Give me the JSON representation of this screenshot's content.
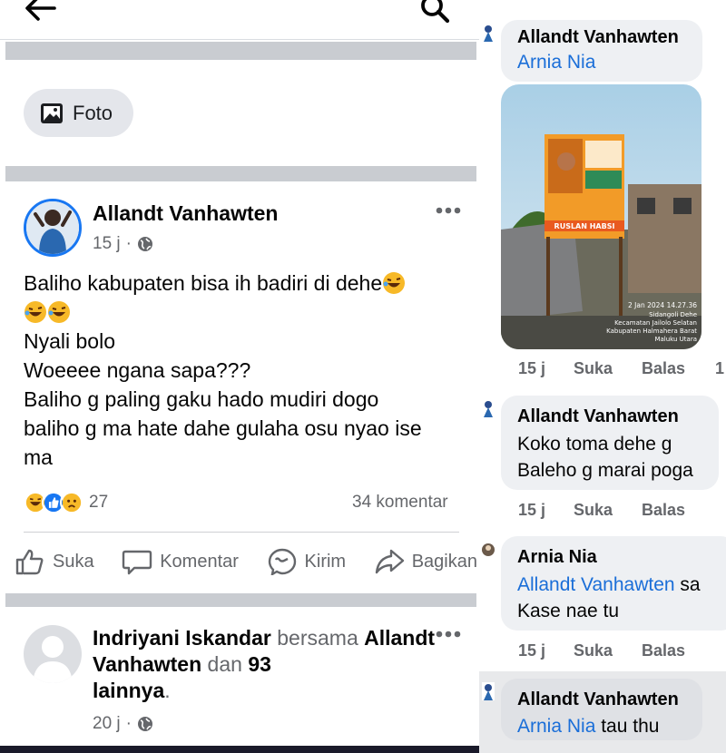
{
  "left": {
    "foto_chip_label": "Foto",
    "post1": {
      "author": "Allandt Vanhawten",
      "time": "15 j",
      "time_sep": "·",
      "body_lines": [
        "Baliho kabupaten bisa ih badiri di dehe",
        "",
        "Nyali bolo",
        "Woeeee ngana sapa???",
        "Baliho g paling gaku hado mudiri dogo",
        "baliho g ma hate dahe gulaha osu nyao ise",
        "ma"
      ],
      "reaction_count": "27",
      "comment_count": "34 komentar",
      "actions": {
        "like": "Suka",
        "comment": "Komentar",
        "send": "Kirim",
        "share": "Bagikan"
      }
    },
    "post2": {
      "author": "Indriyani Iskandar",
      "with_word": "bersama",
      "tagged": "Allandt Vanhawten",
      "and_word": "dan",
      "others_count": "93",
      "others_word": "lainnya",
      "period": ".",
      "time": "20 j",
      "time_sep": "·"
    }
  },
  "right": {
    "comment1": {
      "name": "Allandt Vanhawten",
      "mention": "Arnia Nia"
    },
    "photo_stamp": {
      "line1": "2 Jan 2024 14.27.36",
      "line2": "Sidangoli Dehe",
      "line3": "Kecamatan Jailolo Selatan",
      "line4": "Kabupaten Halmahera Barat",
      "line5": "Maluku Utara"
    },
    "billboard_name": "RUSLAN HABSI",
    "meta1": {
      "time": "15 j",
      "like": "Suka",
      "reply": "Balas",
      "extra": "1"
    },
    "comment2": {
      "name": "Allandt Vanhawten",
      "line1": "Koko toma dehe g",
      "line2": "Baleho g marai poga"
    },
    "meta2": {
      "time": "15 j",
      "like": "Suka",
      "reply": "Balas"
    },
    "comment3": {
      "name": "Arnia Nia",
      "mention": "Allandt Vanhawten",
      "mention_tail": "sa",
      "line2": "Kase nae tu"
    },
    "meta3": {
      "time": "15 j",
      "like": "Suka",
      "reply": "Balas"
    },
    "comment4": {
      "name": "Allandt Vanhawten",
      "mention": "Arnia Nia",
      "text": " tau thu"
    }
  },
  "colors": {
    "link_blue": "#1a6ed8",
    "like_blue": "#1877f2",
    "haha_yellow": "#f7b928",
    "muted_text": "#65676b",
    "divider": "#c9ccd1"
  },
  "icons": [
    "back-arrow-icon",
    "search-icon",
    "photo-icon",
    "globe-icon",
    "more-icon",
    "like-icon",
    "comment-icon",
    "messenger-icon",
    "share-icon"
  ]
}
